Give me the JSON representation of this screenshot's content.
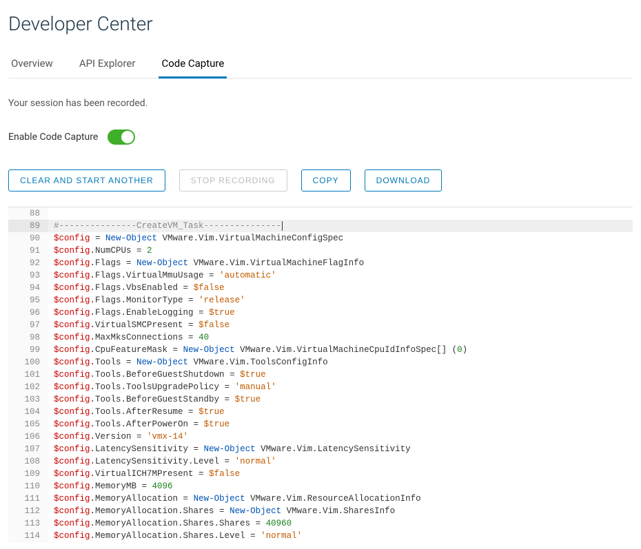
{
  "header": {
    "title": "Developer Center"
  },
  "tabs": [
    {
      "id": "overview",
      "label": "Overview",
      "active": false
    },
    {
      "id": "api-explorer",
      "label": "API Explorer",
      "active": false
    },
    {
      "id": "code-capture",
      "label": "Code Capture",
      "active": true
    }
  ],
  "session_message": "Your session has been recorded.",
  "enable": {
    "label": "Enable Code Capture",
    "on": true
  },
  "buttons": {
    "clear": "CLEAR AND START ANOTHER",
    "stop": "STOP RECORDING",
    "copy": "COPY",
    "download": "DOWNLOAD"
  },
  "code": {
    "first_line": 88,
    "highlight_line": 89,
    "lines": [
      {
        "n": 88,
        "tokens": []
      },
      {
        "n": 89,
        "tokens": [
          {
            "t": "comment",
            "v": "#---------------CreateVM_Task---------------"
          },
          {
            "t": "cursor"
          }
        ]
      },
      {
        "n": 90,
        "tokens": [
          {
            "t": "var",
            "v": "$config"
          },
          {
            "t": "op",
            "v": " = "
          },
          {
            "t": "kw",
            "v": "New-Object"
          },
          {
            "t": "type",
            "v": " VMware.Vim.VirtualMachineConfigSpec"
          }
        ]
      },
      {
        "n": 91,
        "tokens": [
          {
            "t": "var",
            "v": "$config"
          },
          {
            "t": "dot",
            "v": ".NumCPUs "
          },
          {
            "t": "op",
            "v": "= "
          },
          {
            "t": "num",
            "v": "2"
          }
        ]
      },
      {
        "n": 92,
        "tokens": [
          {
            "t": "var",
            "v": "$config"
          },
          {
            "t": "dot",
            "v": ".Flags "
          },
          {
            "t": "op",
            "v": "= "
          },
          {
            "t": "kw",
            "v": "New-Object"
          },
          {
            "t": "type",
            "v": " VMware.Vim.VirtualMachineFlagInfo"
          }
        ]
      },
      {
        "n": 93,
        "tokens": [
          {
            "t": "var",
            "v": "$config"
          },
          {
            "t": "dot",
            "v": ".Flags.VirtualMmuUsage "
          },
          {
            "t": "op",
            "v": "= "
          },
          {
            "t": "str",
            "v": "'automatic'"
          }
        ]
      },
      {
        "n": 94,
        "tokens": [
          {
            "t": "var",
            "v": "$config"
          },
          {
            "t": "dot",
            "v": ".Flags.VbsEnabled "
          },
          {
            "t": "op",
            "v": "= "
          },
          {
            "t": "const",
            "v": "$false"
          }
        ]
      },
      {
        "n": 95,
        "tokens": [
          {
            "t": "var",
            "v": "$config"
          },
          {
            "t": "dot",
            "v": ".Flags.MonitorType "
          },
          {
            "t": "op",
            "v": "= "
          },
          {
            "t": "str",
            "v": "'release'"
          }
        ]
      },
      {
        "n": 96,
        "tokens": [
          {
            "t": "var",
            "v": "$config"
          },
          {
            "t": "dot",
            "v": ".Flags.EnableLogging "
          },
          {
            "t": "op",
            "v": "= "
          },
          {
            "t": "const",
            "v": "$true"
          }
        ]
      },
      {
        "n": 97,
        "tokens": [
          {
            "t": "var",
            "v": "$config"
          },
          {
            "t": "dot",
            "v": ".VirtualSMCPresent "
          },
          {
            "t": "op",
            "v": "= "
          },
          {
            "t": "const",
            "v": "$false"
          }
        ]
      },
      {
        "n": 98,
        "tokens": [
          {
            "t": "var",
            "v": "$config"
          },
          {
            "t": "dot",
            "v": ".MaxMksConnections "
          },
          {
            "t": "op",
            "v": "= "
          },
          {
            "t": "num",
            "v": "40"
          }
        ]
      },
      {
        "n": 99,
        "tokens": [
          {
            "t": "var",
            "v": "$config"
          },
          {
            "t": "dot",
            "v": ".CpuFeatureMask "
          },
          {
            "t": "op",
            "v": "= "
          },
          {
            "t": "kw",
            "v": "New-Object"
          },
          {
            "t": "type",
            "v": " VMware.Vim.VirtualMachineCpuIdInfoSpec[] ("
          },
          {
            "t": "num",
            "v": "0"
          },
          {
            "t": "type",
            "v": ")"
          }
        ]
      },
      {
        "n": 100,
        "tokens": [
          {
            "t": "var",
            "v": "$config"
          },
          {
            "t": "dot",
            "v": ".Tools "
          },
          {
            "t": "op",
            "v": "= "
          },
          {
            "t": "kw",
            "v": "New-Object"
          },
          {
            "t": "type",
            "v": " VMware.Vim.ToolsConfigInfo"
          }
        ]
      },
      {
        "n": 101,
        "tokens": [
          {
            "t": "var",
            "v": "$config"
          },
          {
            "t": "dot",
            "v": ".Tools.BeforeGuestShutdown "
          },
          {
            "t": "op",
            "v": "= "
          },
          {
            "t": "const",
            "v": "$true"
          }
        ]
      },
      {
        "n": 102,
        "tokens": [
          {
            "t": "var",
            "v": "$config"
          },
          {
            "t": "dot",
            "v": ".Tools.ToolsUpgradePolicy "
          },
          {
            "t": "op",
            "v": "= "
          },
          {
            "t": "str",
            "v": "'manual'"
          }
        ]
      },
      {
        "n": 103,
        "tokens": [
          {
            "t": "var",
            "v": "$config"
          },
          {
            "t": "dot",
            "v": ".Tools.BeforeGuestStandby "
          },
          {
            "t": "op",
            "v": "= "
          },
          {
            "t": "const",
            "v": "$true"
          }
        ]
      },
      {
        "n": 104,
        "tokens": [
          {
            "t": "var",
            "v": "$config"
          },
          {
            "t": "dot",
            "v": ".Tools.AfterResume "
          },
          {
            "t": "op",
            "v": "= "
          },
          {
            "t": "const",
            "v": "$true"
          }
        ]
      },
      {
        "n": 105,
        "tokens": [
          {
            "t": "var",
            "v": "$config"
          },
          {
            "t": "dot",
            "v": ".Tools.AfterPowerOn "
          },
          {
            "t": "op",
            "v": "= "
          },
          {
            "t": "const",
            "v": "$true"
          }
        ]
      },
      {
        "n": 106,
        "tokens": [
          {
            "t": "var",
            "v": "$config"
          },
          {
            "t": "dot",
            "v": ".Version "
          },
          {
            "t": "op",
            "v": "= "
          },
          {
            "t": "str",
            "v": "'vmx-14'"
          }
        ]
      },
      {
        "n": 107,
        "tokens": [
          {
            "t": "var",
            "v": "$config"
          },
          {
            "t": "dot",
            "v": ".LatencySensitivity "
          },
          {
            "t": "op",
            "v": "= "
          },
          {
            "t": "kw",
            "v": "New-Object"
          },
          {
            "t": "type",
            "v": " VMware.Vim.LatencySensitivity"
          }
        ]
      },
      {
        "n": 108,
        "tokens": [
          {
            "t": "var",
            "v": "$config"
          },
          {
            "t": "dot",
            "v": ".LatencySensitivity.Level "
          },
          {
            "t": "op",
            "v": "= "
          },
          {
            "t": "str",
            "v": "'normal'"
          }
        ]
      },
      {
        "n": 109,
        "tokens": [
          {
            "t": "var",
            "v": "$config"
          },
          {
            "t": "dot",
            "v": ".VirtualICH7MPresent "
          },
          {
            "t": "op",
            "v": "= "
          },
          {
            "t": "const",
            "v": "$false"
          }
        ]
      },
      {
        "n": 110,
        "tokens": [
          {
            "t": "var",
            "v": "$config"
          },
          {
            "t": "dot",
            "v": ".MemoryMB "
          },
          {
            "t": "op",
            "v": "= "
          },
          {
            "t": "num",
            "v": "4096"
          }
        ]
      },
      {
        "n": 111,
        "tokens": [
          {
            "t": "var",
            "v": "$config"
          },
          {
            "t": "dot",
            "v": ".MemoryAllocation "
          },
          {
            "t": "op",
            "v": "= "
          },
          {
            "t": "kw",
            "v": "New-Object"
          },
          {
            "t": "type",
            "v": " VMware.Vim.ResourceAllocationInfo"
          }
        ]
      },
      {
        "n": 112,
        "tokens": [
          {
            "t": "var",
            "v": "$config"
          },
          {
            "t": "dot",
            "v": ".MemoryAllocation.Shares "
          },
          {
            "t": "op",
            "v": "= "
          },
          {
            "t": "kw",
            "v": "New-Object"
          },
          {
            "t": "type",
            "v": " VMware.Vim.SharesInfo"
          }
        ]
      },
      {
        "n": 113,
        "tokens": [
          {
            "t": "var",
            "v": "$config"
          },
          {
            "t": "dot",
            "v": ".MemoryAllocation.Shares.Shares "
          },
          {
            "t": "op",
            "v": "= "
          },
          {
            "t": "num",
            "v": "40960"
          }
        ]
      },
      {
        "n": 114,
        "tokens": [
          {
            "t": "var",
            "v": "$config"
          },
          {
            "t": "dot",
            "v": ".MemoryAllocation.Shares.Level "
          },
          {
            "t": "op",
            "v": "= "
          },
          {
            "t": "str",
            "v": "'normal'"
          }
        ]
      }
    ]
  }
}
